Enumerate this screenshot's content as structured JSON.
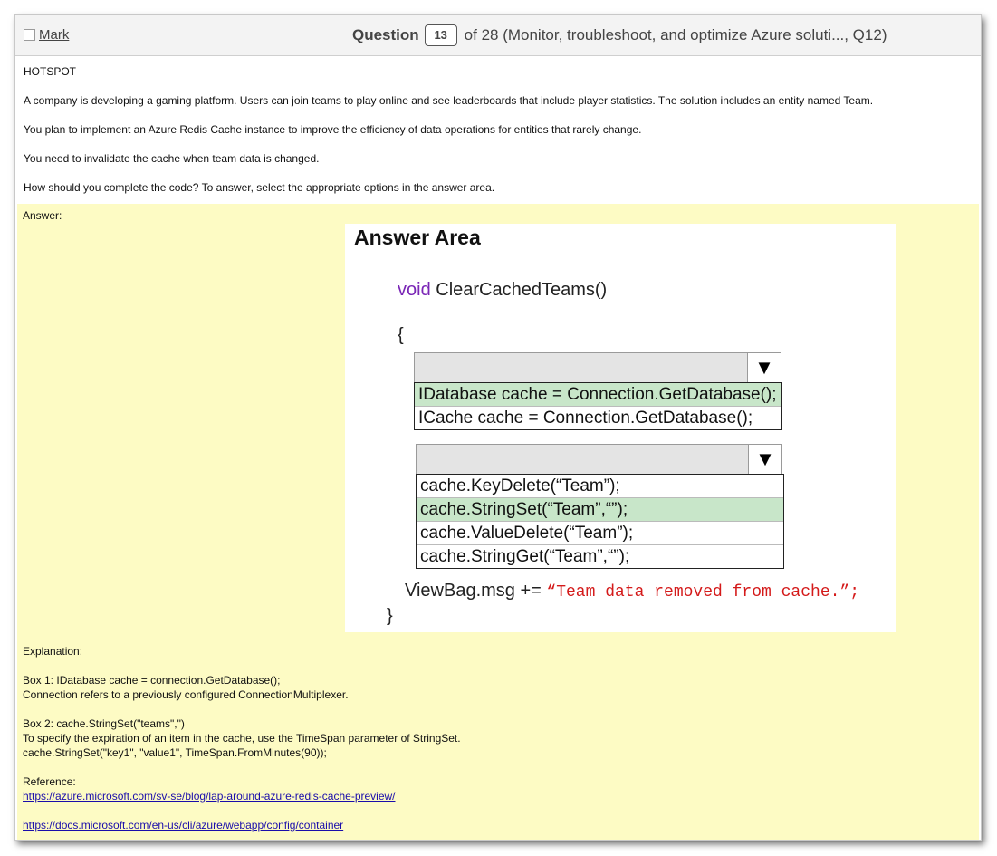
{
  "header": {
    "mark_label": "Mark",
    "question_word": "Question",
    "question_number": "13",
    "question_suffix": "of 28 (Monitor, troubleshoot, and optimize Azure soluti..., Q12)"
  },
  "question": {
    "type": "HOTSPOT",
    "paragraphs": [
      "A company is developing a gaming platform. Users can join teams to play online and see leaderboards that include player statistics. The solution includes an entity named Team.",
      "You plan to implement an Azure Redis Cache instance to improve the efficiency of data operations for entities that rarely change.",
      "You need to invalidate the cache when team data is changed.",
      "How should you complete the code? To answer, select the appropriate options in the answer area."
    ]
  },
  "answer": {
    "label": "Answer:",
    "area_title": "Answer Area",
    "code_keyword": "void",
    "code_method": " ClearCachedTeams()",
    "open_brace": "{",
    "close_brace": "}",
    "dropdown1": {
      "arrow_icon": "▼",
      "options": [
        {
          "text": "IDatabase cache = Connection.GetDatabase();",
          "selected": true
        },
        {
          "text": "ICache cache = Connection.GetDatabase();",
          "selected": false
        }
      ]
    },
    "dropdown2": {
      "arrow_icon": "▼",
      "options": [
        {
          "text": "cache.KeyDelete(“Team”);",
          "selected": false
        },
        {
          "text": "cache.StringSet(“Team”,“”);",
          "selected": true
        },
        {
          "text": "cache.ValueDelete(“Team”);",
          "selected": false
        },
        {
          "text": "cache.StringGet(“Team”,“”);",
          "selected": false
        }
      ]
    },
    "viewbag_prefix": "ViewBag.msg += ",
    "viewbag_string": "“Team data removed from cache.”;"
  },
  "explanation": {
    "label": "Explanation:",
    "box1_title": "Box 1: IDatabase cache = connection.GetDatabase();",
    "box1_text": "Connection refers to a previously configured ConnectionMultiplexer.",
    "box2_title": "Box 2: cache.StringSet(\"teams\",\")",
    "box2_text": "To specify the expiration of an item in the cache, use the TimeSpan parameter of StringSet.",
    "box2_code": "cache.StringSet(\"key1\", \"value1\", TimeSpan.FromMinutes(90));",
    "reference_label": "Reference:",
    "link1": "https://azure.microsoft.com/sv-se/blog/lap-around-azure-redis-cache-preview/",
    "link2": "https://docs.microsoft.com/en-us/cli/azure/webapp/config/container"
  },
  "colors": {
    "answer_bg": "#fdfbc4",
    "selected_option": "#c8e6c9",
    "keyword": "#7a26b6",
    "string_literal": "#d41a1a",
    "link": "#1a0dab"
  }
}
